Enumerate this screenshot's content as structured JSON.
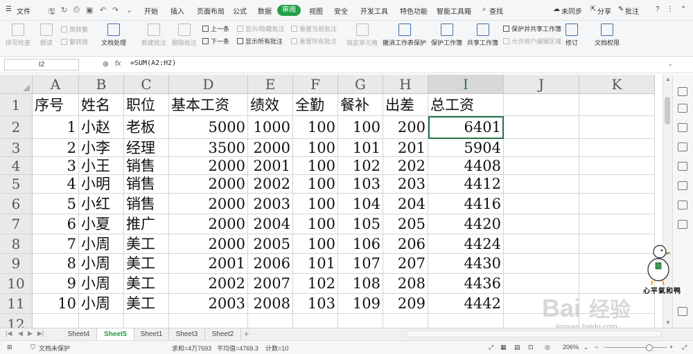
{
  "menu": {
    "file": "文件",
    "tabs": [
      "开始",
      "插入",
      "页面布局",
      "公式",
      "数据",
      "审阅",
      "视图",
      "安全",
      "开发工具",
      "特色功能",
      "智能工具箱"
    ],
    "active_tab": "审阅",
    "search": "查找",
    "sync": "未同步",
    "share": "分享",
    "comment": "批注"
  },
  "ribbon": {
    "spellcheck": "拼写检查",
    "read": "朗读",
    "trad1": "简转繁",
    "trad2": "繁转简",
    "text_process": "文档处理",
    "new_comment": "新建批注",
    "del_comment": "删除批注",
    "prev": "上一条",
    "next": "下一条",
    "show_hide": "显示/隐藏批注",
    "show_all": "显示所有批注",
    "reset_cur": "重置当前批注",
    "reset_all": "重置所有批注",
    "lock_cell": "锁定单元格",
    "unprotect_sheet": "撤消工作表保护",
    "protect_book": "保护工作簿",
    "share_book": "共享工作簿",
    "protect_share": "保护并共享工作簿",
    "allow_edit": "允许用户编辑区域",
    "revise": "修订",
    "doc_rights": "文档权限"
  },
  "formula_bar": {
    "cell_ref": "I2",
    "fx": "fx",
    "formula": "=SUM(A2:H2)"
  },
  "grid": {
    "columns": [
      "A",
      "B",
      "C",
      "D",
      "E",
      "F",
      "G",
      "H",
      "I",
      "J",
      "K"
    ],
    "selected_column": "I",
    "row_numbers": [
      "1",
      "2",
      "3",
      "4",
      "5",
      "6",
      "7",
      "8",
      "9",
      "10",
      "11",
      "12"
    ],
    "header": [
      "序号",
      "姓名",
      "职位",
      "基本工资",
      "绩效",
      "全勤",
      "餐补",
      "出差",
      "总工资"
    ],
    "rows": [
      [
        "1",
        "小赵",
        "老板",
        "5000",
        "1000",
        "100",
        "100",
        "200",
        "6401"
      ],
      [
        "2",
        "小李",
        "经理",
        "3500",
        "2000",
        "100",
        "101",
        "201",
        "5904"
      ],
      [
        "3",
        "小王",
        "销售",
        "2000",
        "2001",
        "100",
        "102",
        "202",
        "4408"
      ],
      [
        "4",
        "小明",
        "销售",
        "2000",
        "2002",
        "100",
        "103",
        "203",
        "4412"
      ],
      [
        "5",
        "小红",
        "销售",
        "2000",
        "2003",
        "100",
        "104",
        "204",
        "4416"
      ],
      [
        "6",
        "小夏",
        "推广",
        "2000",
        "2004",
        "100",
        "105",
        "205",
        "4420"
      ],
      [
        "7",
        "小周",
        "美工",
        "2000",
        "2005",
        "100",
        "106",
        "206",
        "4424"
      ],
      [
        "8",
        "小周",
        "美工",
        "2001",
        "2006",
        "101",
        "107",
        "207",
        "4430"
      ],
      [
        "9",
        "小周",
        "美工",
        "2002",
        "2007",
        "102",
        "108",
        "208",
        "4436"
      ],
      [
        "10",
        "小周",
        "美工",
        "2003",
        "2008",
        "103",
        "109",
        "209",
        "4442"
      ]
    ]
  },
  "sheets": {
    "tabs": [
      "Sheet4",
      "Sheet5",
      "Sheet1",
      "Sheet3",
      "Sheet2"
    ],
    "active": "Sheet5",
    "add": "+"
  },
  "status": {
    "doc_protect": "文档未保护",
    "sum": "求和=4万7693",
    "avg": "平均值=4769.3",
    "count": "计数=10",
    "zoom": "206%"
  },
  "watermark": {
    "brand": "Bai经验",
    "url": "jingyan.baidu.com",
    "author": "心平氣和鸭"
  },
  "colors": {
    "accent": "#22a148",
    "active_sheet": "#1e9b3b"
  }
}
